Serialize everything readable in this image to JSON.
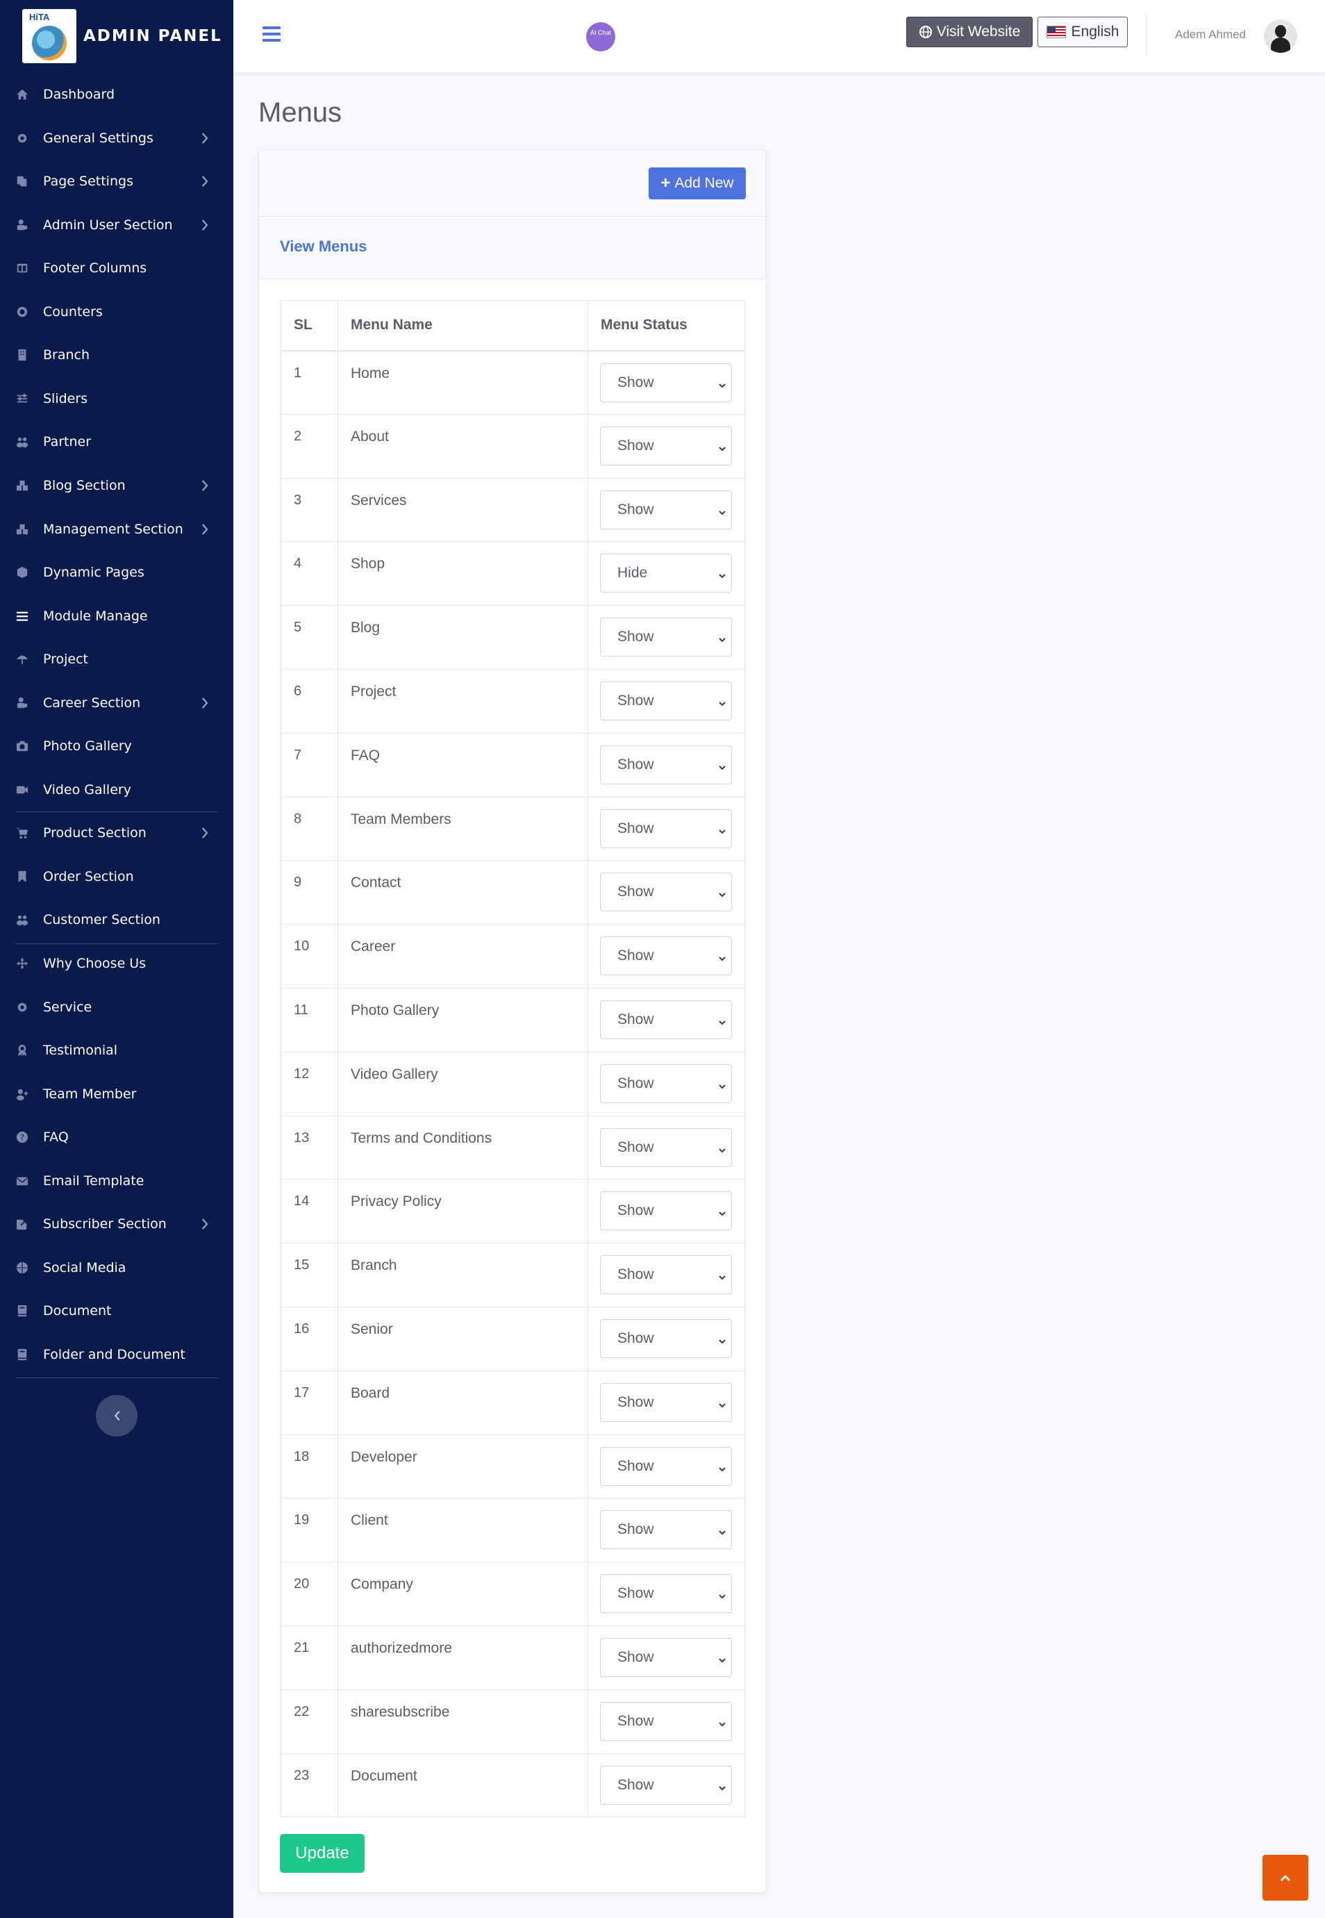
{
  "brand": {
    "logo_text": "HiTA",
    "name": "ADMIN PANEL"
  },
  "sidebar": {
    "items": [
      {
        "label": "Dashboard",
        "icon": "home-icon",
        "has_children": false,
        "active": false
      },
      {
        "label": "General Settings",
        "icon": "cog-icon",
        "has_children": true,
        "active": false
      },
      {
        "label": "Page Settings",
        "icon": "copy-icon",
        "has_children": true,
        "active": false
      },
      {
        "label": "Admin User Section",
        "icon": "user-lock-icon",
        "has_children": true,
        "active": false
      },
      {
        "label": "Footer Columns",
        "icon": "columns-icon",
        "has_children": false,
        "active": false
      },
      {
        "label": "Counters",
        "icon": "fingerprint-icon",
        "has_children": false,
        "active": false
      },
      {
        "label": "Branch",
        "icon": "building-icon",
        "has_children": false,
        "active": false
      },
      {
        "label": "Sliders",
        "icon": "sliders-icon",
        "has_children": false,
        "active": false
      },
      {
        "label": "Partner",
        "icon": "users-icon",
        "has_children": false,
        "active": false
      },
      {
        "label": "Blog Section",
        "icon": "cubes-icon",
        "has_children": true,
        "active": false
      },
      {
        "label": "Management Section",
        "icon": "cubes-icon",
        "has_children": true,
        "active": false
      },
      {
        "label": "Dynamic Pages",
        "icon": "cube-icon",
        "has_children": false,
        "active": false
      },
      {
        "label": "Module Manage",
        "icon": "bars-icon",
        "has_children": false,
        "active": true
      },
      {
        "label": "Project",
        "icon": "umbrella-icon",
        "has_children": false,
        "active": false
      },
      {
        "label": "Career Section",
        "icon": "user-lock-icon",
        "has_children": true,
        "active": false
      },
      {
        "label": "Photo Gallery",
        "icon": "camera-icon",
        "has_children": false,
        "active": false
      },
      {
        "label": "Video Gallery",
        "icon": "video-icon",
        "has_children": false,
        "active": false
      },
      {
        "label": "Product Section",
        "icon": "cart-icon",
        "has_children": true,
        "active": false
      },
      {
        "label": "Order Section",
        "icon": "bookmark-icon",
        "has_children": false,
        "active": false
      },
      {
        "label": "Customer Section",
        "icon": "users-icon",
        "has_children": false,
        "active": false
      },
      {
        "label": "Why Choose Us",
        "icon": "arrows-icon",
        "has_children": false,
        "active": false
      },
      {
        "label": "Service",
        "icon": "gear-icon",
        "has_children": false,
        "active": false
      },
      {
        "label": "Testimonial",
        "icon": "award-icon",
        "has_children": false,
        "active": false
      },
      {
        "label": "Team Member",
        "icon": "user-plus-icon",
        "has_children": false,
        "active": false
      },
      {
        "label": "FAQ",
        "icon": "question-circle-icon",
        "has_children": false,
        "active": false
      },
      {
        "label": "Email Template",
        "icon": "envelope-icon",
        "has_children": false,
        "active": false
      },
      {
        "label": "Subscriber Section",
        "icon": "share-square-icon",
        "has_children": true,
        "active": false
      },
      {
        "label": "Social Media",
        "icon": "basketball-icon",
        "has_children": false,
        "active": false
      },
      {
        "label": "Document",
        "icon": "book-icon",
        "has_children": false,
        "active": false
      },
      {
        "label": "Folder and Document",
        "icon": "book-icon",
        "has_children": false,
        "active": false
      }
    ]
  },
  "topbar": {
    "ai_chat_label": "AI Chat",
    "visit_label": "Visit Website",
    "language_label": "English",
    "user_name": "Adem Ahmed"
  },
  "page": {
    "title": "Menus"
  },
  "card": {
    "add_label": "Add New",
    "view_title": "View Menus",
    "update_label": "Update"
  },
  "table": {
    "headers": [
      "SL",
      "Menu Name",
      "Menu Status"
    ],
    "rows": [
      {
        "sl": "1",
        "name": "Home",
        "status": "Show"
      },
      {
        "sl": "2",
        "name": "About",
        "status": "Show"
      },
      {
        "sl": "3",
        "name": "Services",
        "status": "Show"
      },
      {
        "sl": "4",
        "name": "Shop",
        "status": "Hide"
      },
      {
        "sl": "5",
        "name": "Blog",
        "status": "Show"
      },
      {
        "sl": "6",
        "name": "Project",
        "status": "Show"
      },
      {
        "sl": "7",
        "name": "FAQ",
        "status": "Show"
      },
      {
        "sl": "8",
        "name": "Team Members",
        "status": "Show"
      },
      {
        "sl": "9",
        "name": "Contact",
        "status": "Show"
      },
      {
        "sl": "10",
        "name": "Career",
        "status": "Show"
      },
      {
        "sl": "11",
        "name": "Photo Gallery",
        "status": "Show"
      },
      {
        "sl": "12",
        "name": "Video Gallery",
        "status": "Show"
      },
      {
        "sl": "13",
        "name": "Terms and Conditions",
        "status": "Show"
      },
      {
        "sl": "14",
        "name": "Privacy Policy",
        "status": "Show"
      },
      {
        "sl": "15",
        "name": "Branch",
        "status": "Show"
      },
      {
        "sl": "16",
        "name": "Senior",
        "status": "Show"
      },
      {
        "sl": "17",
        "name": "Board",
        "status": "Show"
      },
      {
        "sl": "18",
        "name": "Developer",
        "status": "Show"
      },
      {
        "sl": "19",
        "name": "Client",
        "status": "Show"
      },
      {
        "sl": "20",
        "name": "Company",
        "status": "Show"
      },
      {
        "sl": "21",
        "name": "authorizedmore",
        "status": "Show"
      },
      {
        "sl": "22",
        "name": "sharesubscribe",
        "status": "Show"
      },
      {
        "sl": "23",
        "name": "Document",
        "status": "Show"
      }
    ]
  },
  "colors": {
    "sidebar_bg": "#0a1a4a",
    "primary": "#4e73df",
    "success": "#1cc88a",
    "scroll_top": "#e8590c"
  }
}
